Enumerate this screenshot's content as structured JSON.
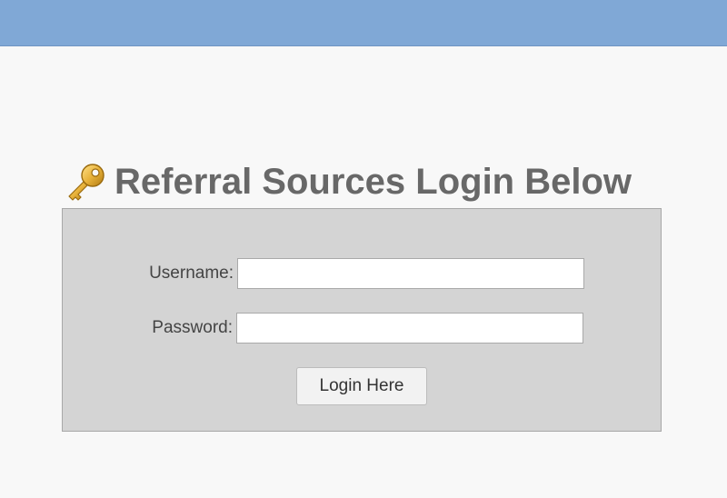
{
  "header": {
    "bar_color": "#80a8d6"
  },
  "login": {
    "icon": "key-icon",
    "title": "Referral Sources Login Below",
    "username_label": "Username:",
    "username_value": "",
    "password_label": "Password:",
    "password_value": "",
    "submit_label": "Login Here"
  }
}
